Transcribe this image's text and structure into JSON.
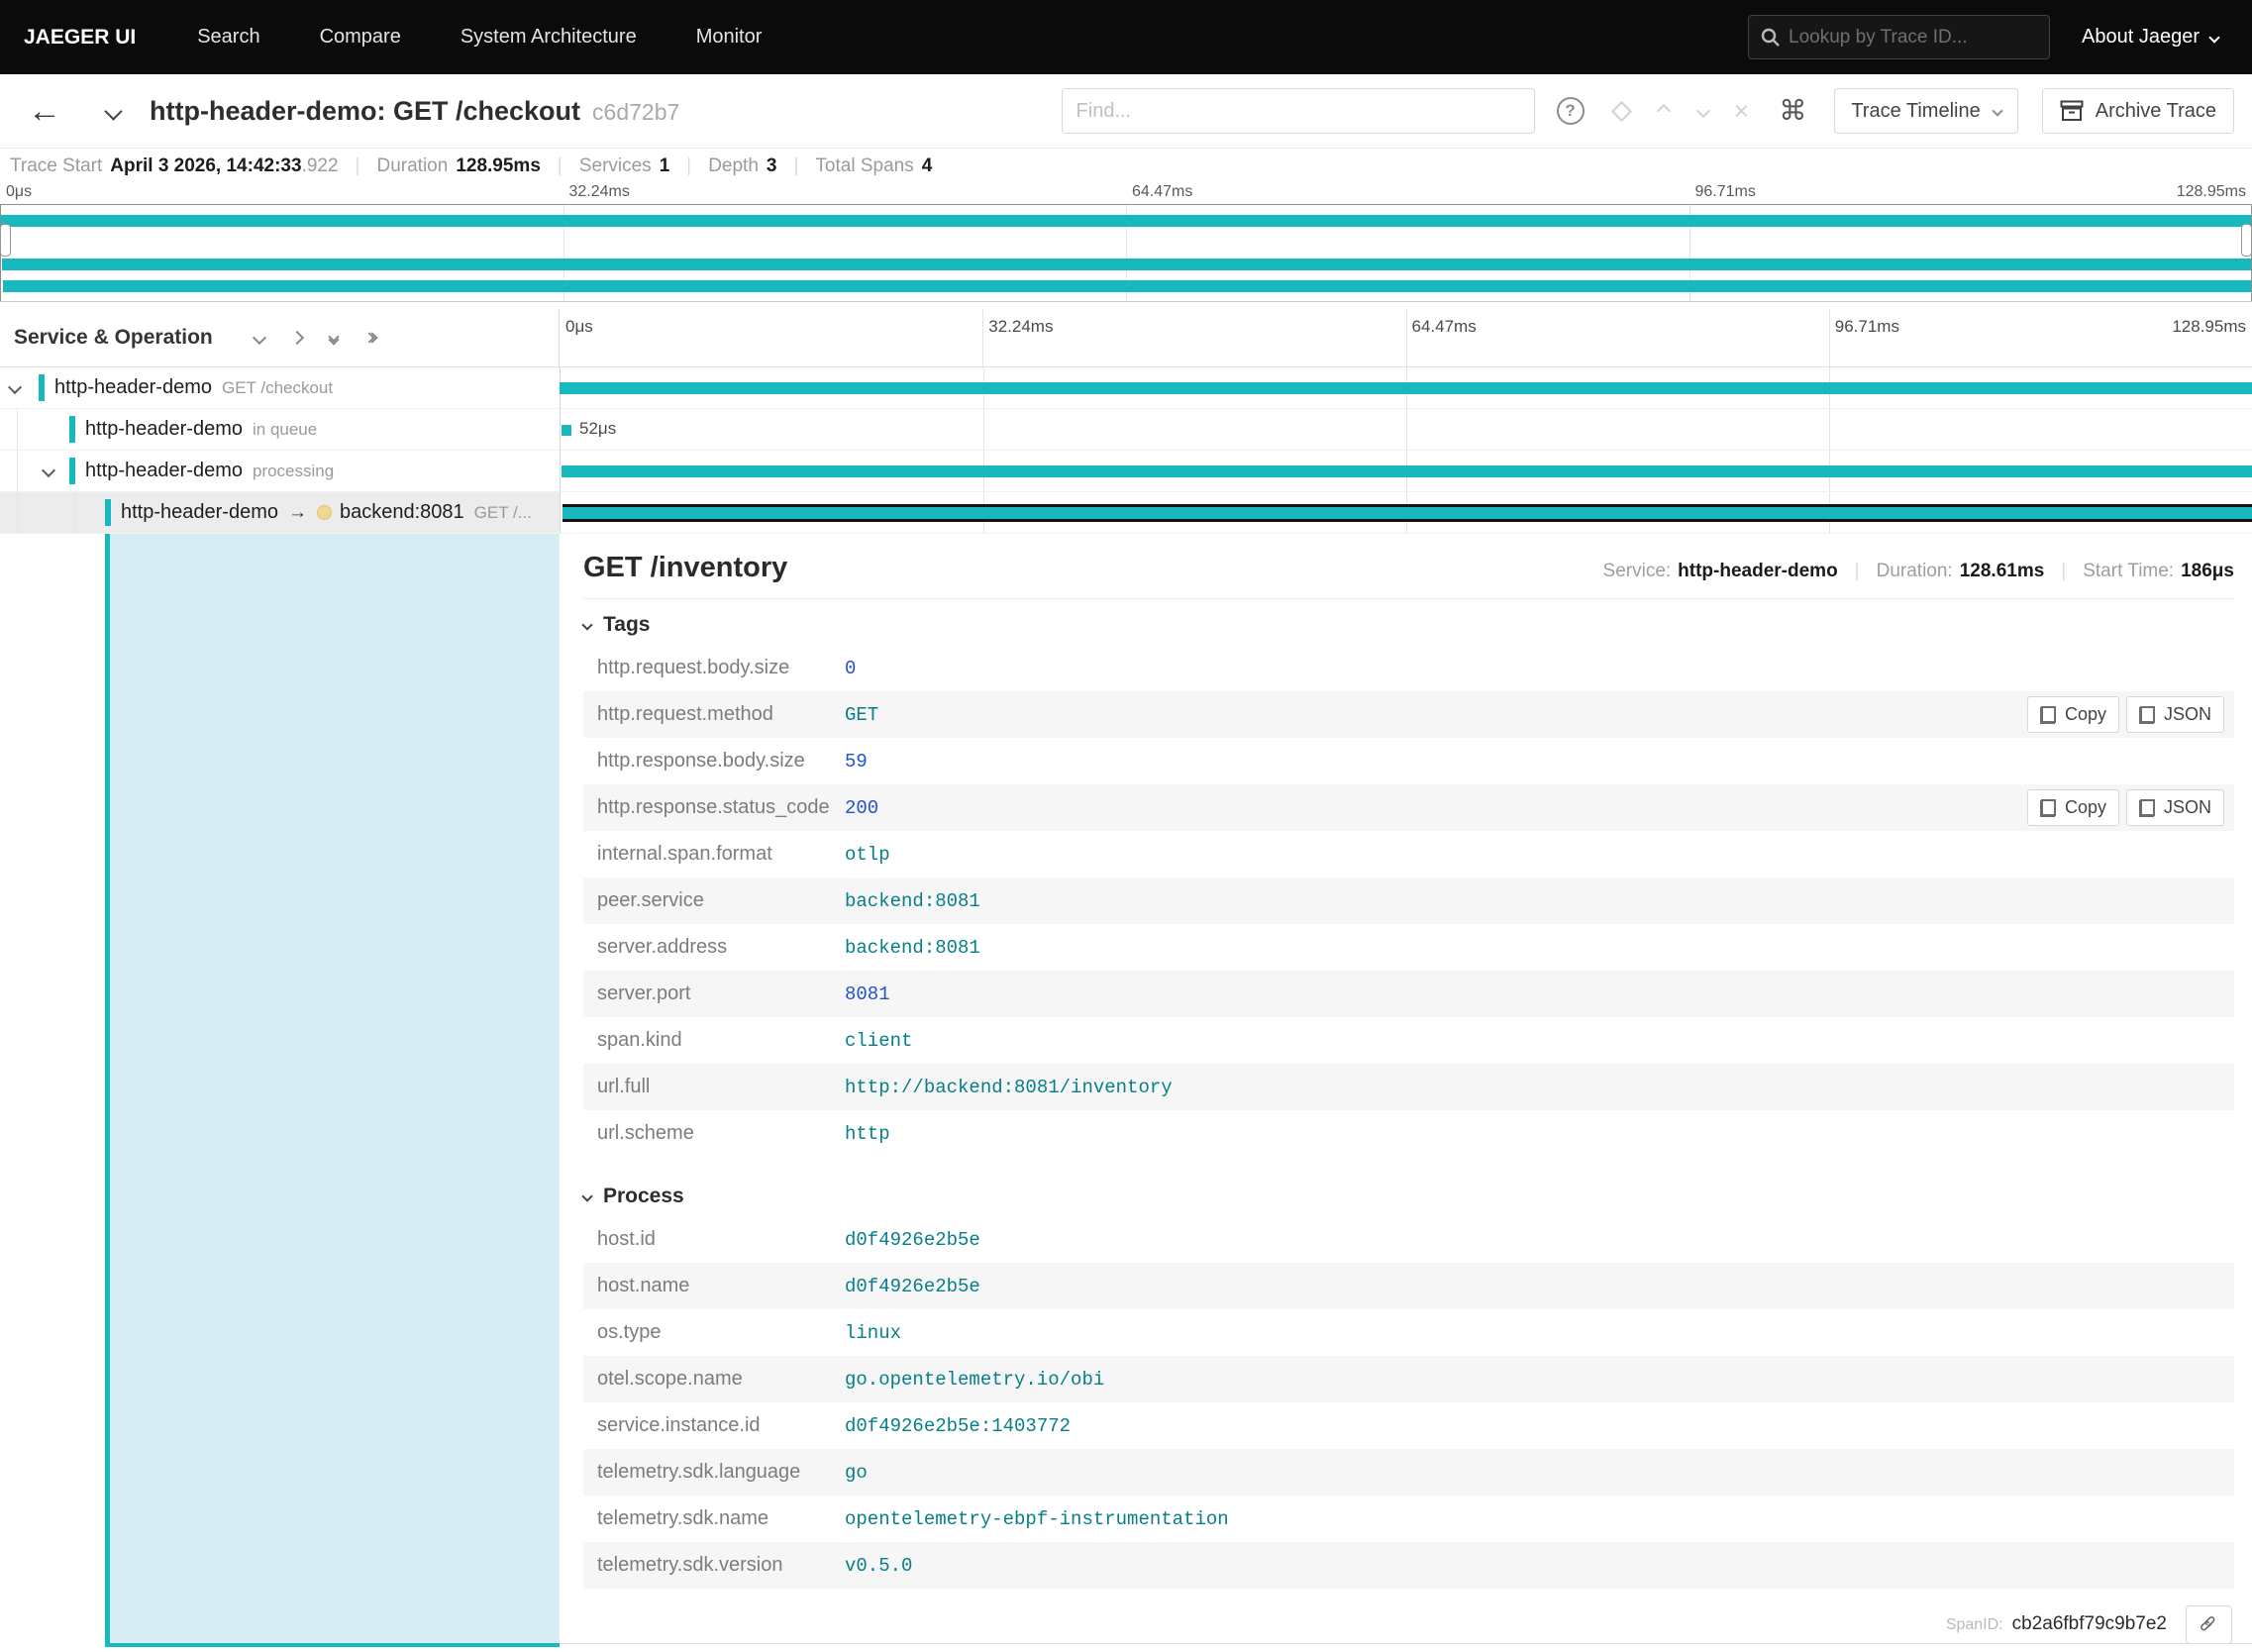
{
  "topnav": {
    "brand": "JAEGER UI",
    "items": [
      "Search",
      "Compare",
      "System Architecture",
      "Monitor"
    ],
    "trace_lookup_placeholder": "Lookup by Trace ID...",
    "about": "About Jaeger"
  },
  "trace_header": {
    "title": "http-header-demo: GET /checkout",
    "trace_id_short": "c6d72b7",
    "find_placeholder": "Find...",
    "view_selector": "Trace Timeline",
    "archive_label": "Archive Trace",
    "help_glyph": "?",
    "shortcut_glyph": "⌘",
    "clear_glyph": "×",
    "back_glyph": "←"
  },
  "summary": {
    "trace_start_label": "Trace Start",
    "trace_start_value": "April 3 2026, 14:42:33",
    "trace_start_ms": ".922",
    "duration_label": "Duration",
    "duration_value": "128.95ms",
    "services_label": "Services",
    "services_value": "1",
    "depth_label": "Depth",
    "depth_value": "3",
    "total_spans_label": "Total Spans",
    "total_spans_value": "4"
  },
  "timeline": {
    "left_header": "Service & Operation",
    "ticks": [
      "0μs",
      "32.24ms",
      "64.47ms",
      "96.71ms",
      "128.95ms"
    ]
  },
  "icons": {
    "arrow": "→"
  },
  "spans": [
    {
      "service": "http-header-demo",
      "operation": "GET /checkout",
      "depth": 0,
      "caret": true,
      "selected": false,
      "bar": {
        "start": 0,
        "width": 100
      }
    },
    {
      "service": "http-header-demo",
      "operation": "in queue",
      "depth": 1,
      "caret": false,
      "selected": false,
      "bar": {
        "start": 0,
        "width": 0.04
      },
      "duration_label": "52μs"
    },
    {
      "service": "http-header-demo",
      "operation": "processing",
      "depth": 1,
      "caret": true,
      "selected": false,
      "bar": {
        "start": 0.1,
        "width": 99.9
      }
    },
    {
      "service": "http-header-demo",
      "operation": "GET /...",
      "depth": 2,
      "caret": false,
      "selected": true,
      "peer": "backend:8081",
      "bar": {
        "start": 0.15,
        "width": 99.85
      }
    }
  ],
  "detail": {
    "title": "GET /inventory",
    "service_label": "Service:",
    "service_value": "http-header-demo",
    "duration_label": "Duration:",
    "duration_value": "128.61ms",
    "start_label": "Start Time:",
    "start_value": "186μs",
    "tags_header": "Tags",
    "process_header": "Process",
    "copy_label": "Copy",
    "json_label": "JSON",
    "spanid_label": "SpanID:",
    "spanid_value": "cb2a6fbf79c9b7e2",
    "tags": [
      {
        "key": "http.request.body.size",
        "value": "0"
      },
      {
        "key": "http.request.method",
        "value": "GET",
        "buttons": true
      },
      {
        "key": "http.response.body.size",
        "value": "59"
      },
      {
        "key": "http.response.status_code",
        "value": "200",
        "buttons": true
      },
      {
        "key": "internal.span.format",
        "value": "otlp"
      },
      {
        "key": "peer.service",
        "value": "backend:8081"
      },
      {
        "key": "server.address",
        "value": "backend:8081"
      },
      {
        "key": "server.port",
        "value": "8081"
      },
      {
        "key": "span.kind",
        "value": "client"
      },
      {
        "key": "url.full",
        "value": "http://backend:8081/inventory"
      },
      {
        "key": "url.scheme",
        "value": "http"
      }
    ],
    "process": [
      {
        "key": "host.id",
        "value": "d0f4926e2b5e"
      },
      {
        "key": "host.name",
        "value": "d0f4926e2b5e"
      },
      {
        "key": "os.type",
        "value": "linux"
      },
      {
        "key": "otel.scope.name",
        "value": "go.opentelemetry.io/obi"
      },
      {
        "key": "service.instance.id",
        "value": "d0f4926e2b5e:1403772"
      },
      {
        "key": "telemetry.sdk.language",
        "value": "go"
      },
      {
        "key": "telemetry.sdk.name",
        "value": "opentelemetry-ebpf-instrumentation"
      },
      {
        "key": "telemetry.sdk.version",
        "value": "v0.5.0"
      }
    ]
  },
  "colors": {
    "accent": "#17b8be",
    "detail_strip": "#d7ecf3",
    "value_string": "#067f87",
    "value_number": "#2451cc"
  }
}
